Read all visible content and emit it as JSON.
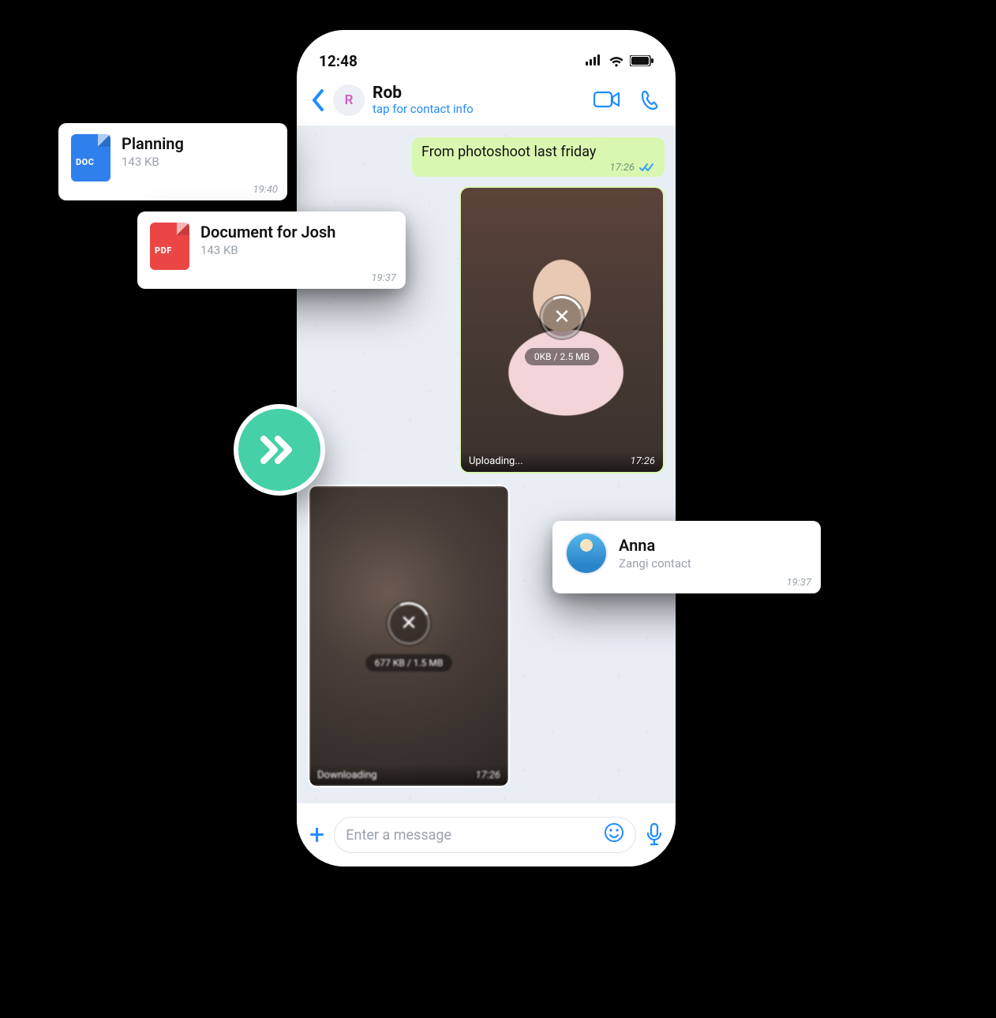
{
  "statusbar": {
    "time": "12:48"
  },
  "header": {
    "avatar_initial": "R",
    "name": "Rob",
    "subtitle": "tap for contact info"
  },
  "messages": {
    "out_text": {
      "text": "From photoshoot last friday",
      "time": "17:26"
    },
    "out_media": {
      "status_label": "Uploading...",
      "progress": "0KB / 2.5 MB",
      "time": "17:26"
    },
    "in_media": {
      "status_label": "Downloading",
      "progress": "677 KB / 1.5 MB",
      "time": "17:26"
    }
  },
  "composer": {
    "placeholder": "Enter a message"
  },
  "cards": {
    "planning": {
      "icon_label": "DOC",
      "title": "Planning",
      "size": "143 KB",
      "time": "19:40"
    },
    "pdf": {
      "icon_label": "PDF",
      "title": "Document for Josh",
      "size": "143 KB",
      "time": "19:37"
    },
    "anna": {
      "name": "Anna",
      "subtitle": "Zangi contact",
      "time": "19:37"
    }
  }
}
